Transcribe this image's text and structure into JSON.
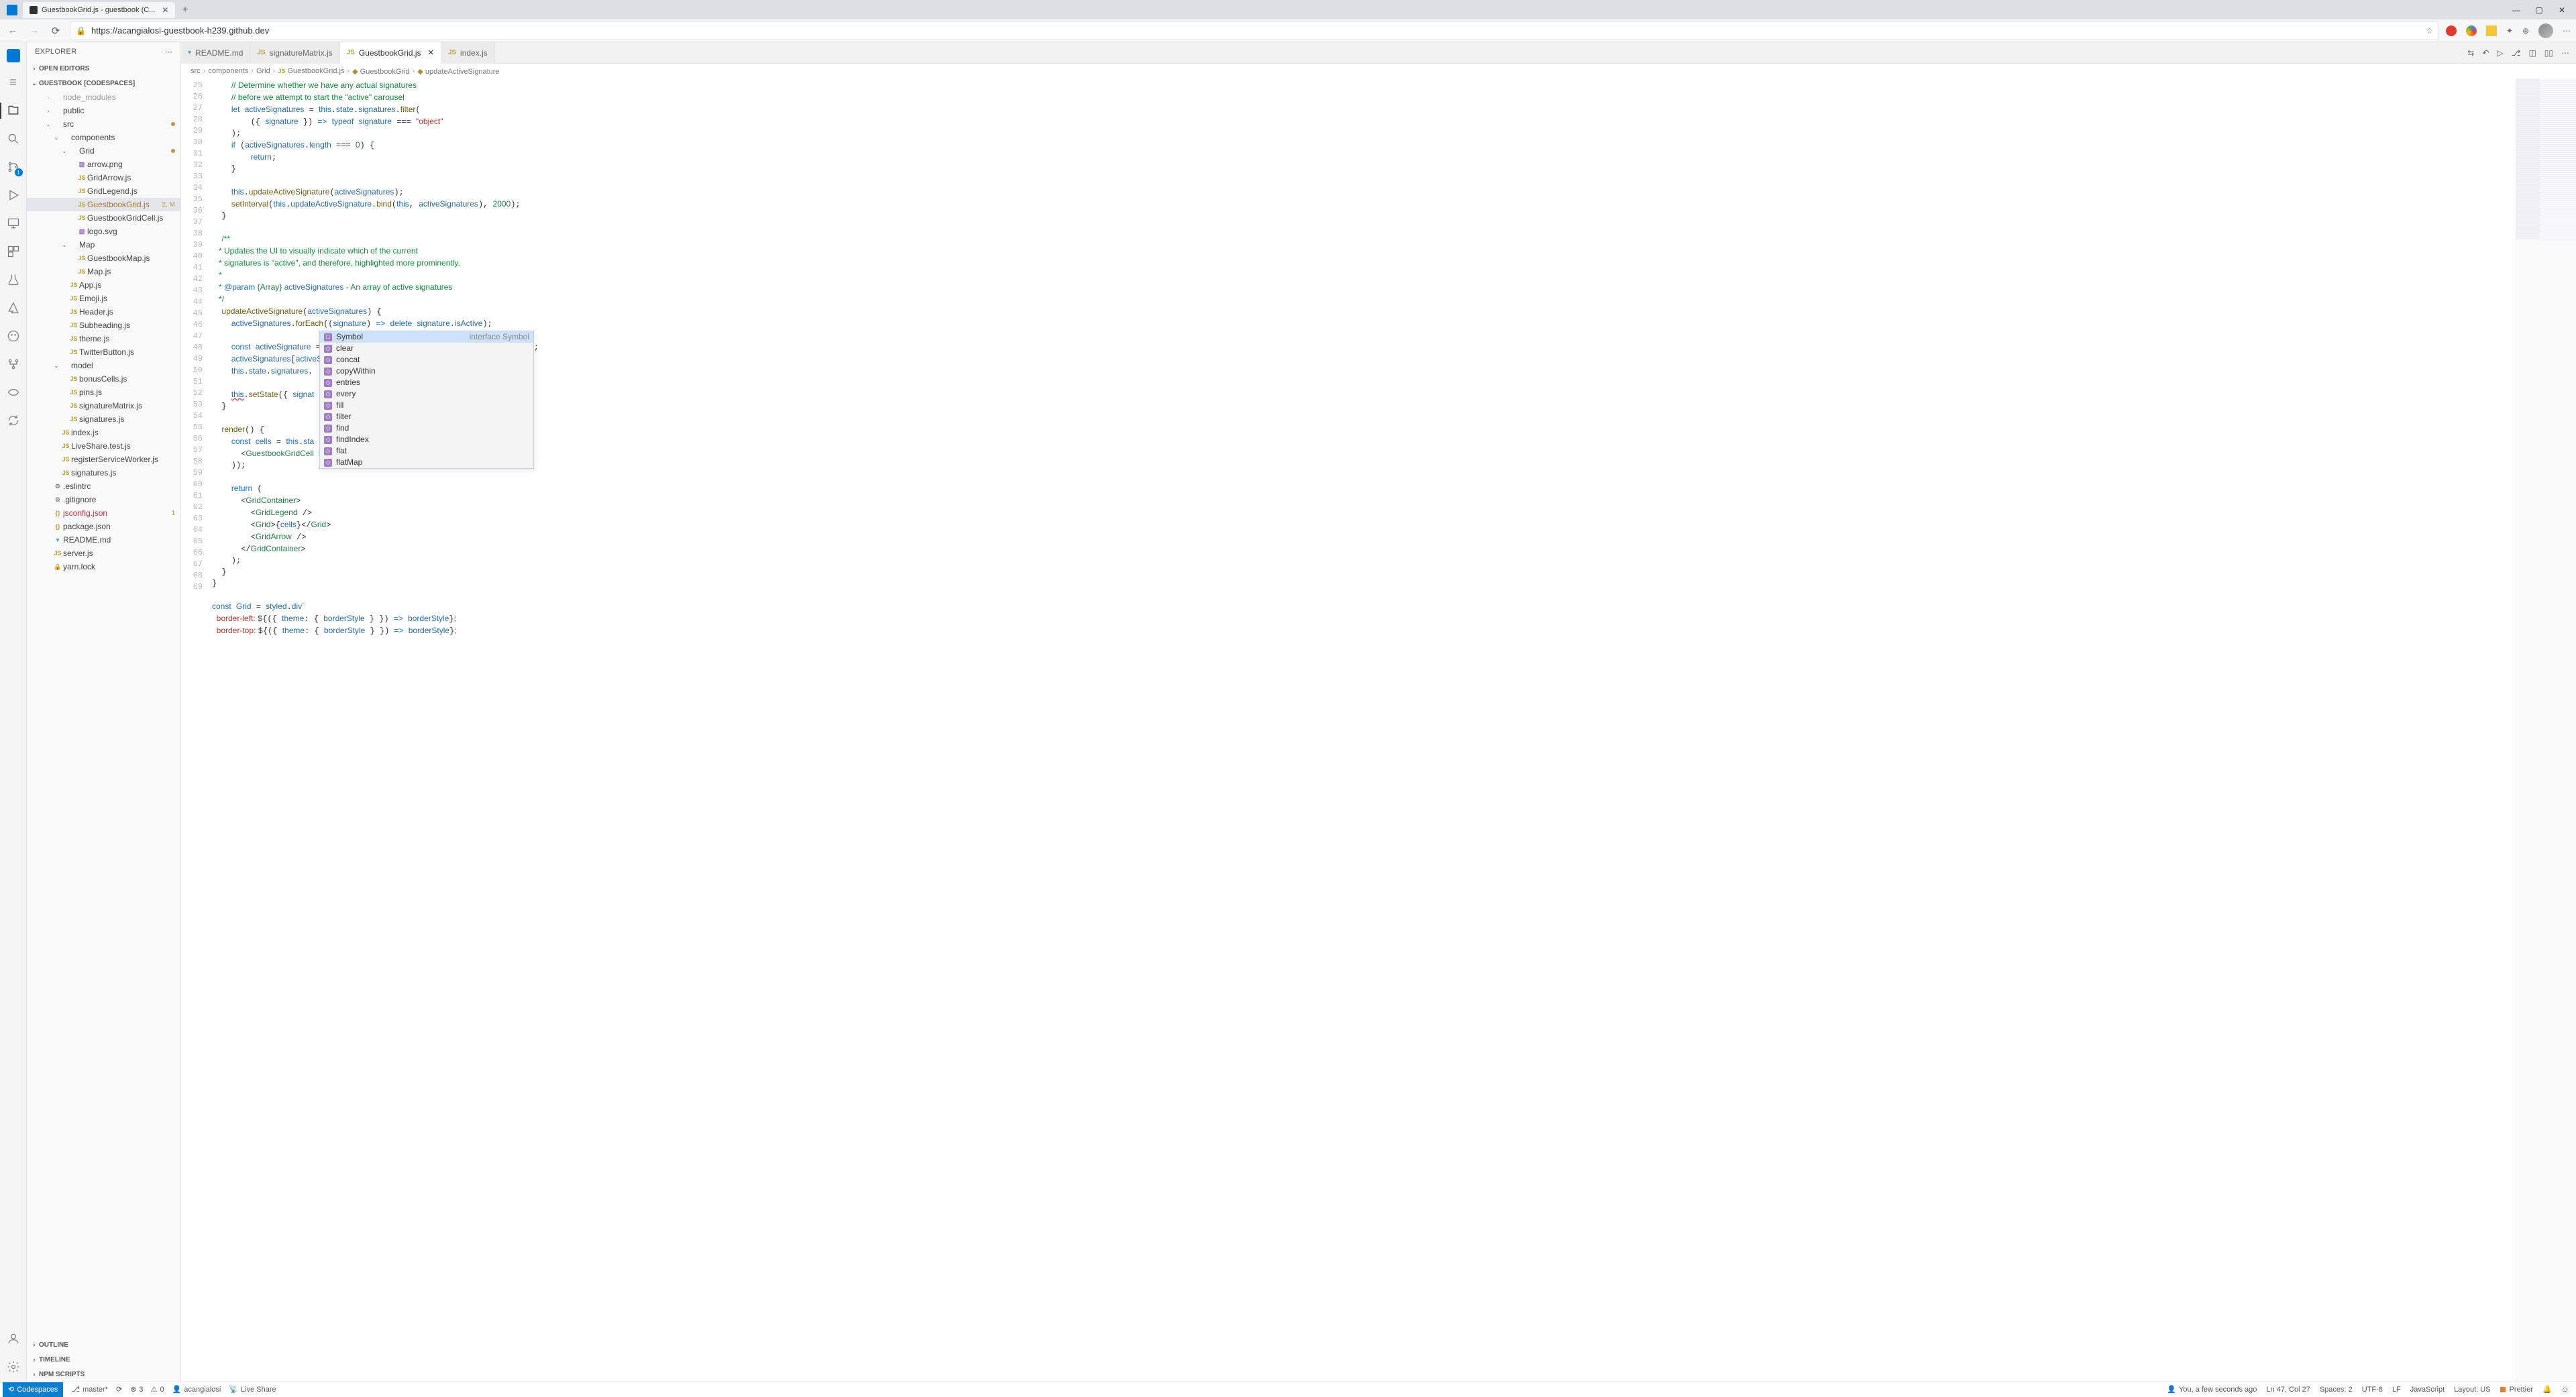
{
  "browser": {
    "tab_title": "GuestbookGrid.js - guestbook (C...",
    "url": "https://acangialosi-guestbook-h239.github.dev"
  },
  "window_controls": {
    "min": "—",
    "max": "▢",
    "close": "✕"
  },
  "sidebar": {
    "title": "Explorer",
    "sections": {
      "open_editors": "OPEN EDITORS",
      "repo": "GUESTBOOK [CODESPACES]",
      "outline": "OUTLINE",
      "timeline": "TIMELINE",
      "npm": "NPM SCRIPTS"
    },
    "tree": [
      {
        "name": "node_modules",
        "type": "folder",
        "indent": 2,
        "expanded": false,
        "dim": true
      },
      {
        "name": "public",
        "type": "folder",
        "indent": 2,
        "expanded": false
      },
      {
        "name": "src",
        "type": "folder",
        "indent": 2,
        "expanded": true,
        "dot": true
      },
      {
        "name": "components",
        "type": "folder",
        "indent": 3,
        "expanded": true
      },
      {
        "name": "Grid",
        "type": "folder",
        "indent": 4,
        "expanded": true,
        "dot": true
      },
      {
        "name": "arrow.png",
        "type": "img",
        "indent": 5
      },
      {
        "name": "GridArrow.js",
        "type": "js",
        "indent": 5
      },
      {
        "name": "GridLegend.js",
        "type": "js",
        "indent": 5
      },
      {
        "name": "GuestbookGrid.js",
        "type": "js",
        "indent": 5,
        "selected": true,
        "mark": "2, M",
        "modified": true
      },
      {
        "name": "GuestbookGridCell.js",
        "type": "js",
        "indent": 5
      },
      {
        "name": "logo.svg",
        "type": "img",
        "indent": 5
      },
      {
        "name": "Map",
        "type": "folder",
        "indent": 4,
        "expanded": true
      },
      {
        "name": "GuestbookMap.js",
        "type": "js",
        "indent": 5
      },
      {
        "name": "Map.js",
        "type": "js",
        "indent": 5
      },
      {
        "name": "App.js",
        "type": "js",
        "indent": 4
      },
      {
        "name": "Emoji.js",
        "type": "js",
        "indent": 4
      },
      {
        "name": "Header.js",
        "type": "js",
        "indent": 4
      },
      {
        "name": "Subheading.js",
        "type": "js",
        "indent": 4
      },
      {
        "name": "theme.js",
        "type": "js",
        "indent": 4
      },
      {
        "name": "TwitterButton.js",
        "type": "js",
        "indent": 4
      },
      {
        "name": "model",
        "type": "folder",
        "indent": 3,
        "expanded": true
      },
      {
        "name": "bonusCells.js",
        "type": "js",
        "indent": 4
      },
      {
        "name": "pins.js",
        "type": "js",
        "indent": 4
      },
      {
        "name": "signatureMatrix.js",
        "type": "js",
        "indent": 4
      },
      {
        "name": "signatures.js",
        "type": "js",
        "indent": 4
      },
      {
        "name": "index.js",
        "type": "js",
        "indent": 3
      },
      {
        "name": "LiveShare.test.js",
        "type": "js",
        "indent": 3
      },
      {
        "name": "registerServiceWorker.js",
        "type": "js",
        "indent": 3
      },
      {
        "name": "signatures.js",
        "type": "js",
        "indent": 3
      },
      {
        "name": ".eslintrc",
        "type": "config",
        "indent": 2
      },
      {
        "name": ".gitignore",
        "type": "config",
        "indent": 2
      },
      {
        "name": "jsconfig.json",
        "type": "json",
        "indent": 2,
        "error": true,
        "mark": "1"
      },
      {
        "name": "package.json",
        "type": "json",
        "indent": 2
      },
      {
        "name": "README.md",
        "type": "md",
        "indent": 2
      },
      {
        "name": "server.js",
        "type": "js",
        "indent": 2
      },
      {
        "name": "yarn.lock",
        "type": "lock",
        "indent": 2
      }
    ]
  },
  "tabs": [
    {
      "label": "README.md",
      "icon": "md"
    },
    {
      "label": "signatureMatrix.js",
      "icon": "js"
    },
    {
      "label": "GuestbookGrid.js",
      "icon": "js",
      "active": true,
      "close": true
    },
    {
      "label": "index.js",
      "icon": "js"
    }
  ],
  "breadcrumb": [
    "src",
    "components",
    "Grid",
    "GuestbookGrid.js",
    "GuestbookGrid",
    "updateActiveSignature"
  ],
  "gutter_start": 25,
  "gutter_end": 69,
  "suggest": {
    "detail": "interface Symbol",
    "items": [
      "Symbol",
      "clear",
      "concat",
      "copyWithin",
      "entries",
      "every",
      "fill",
      "filter",
      "find",
      "findIndex",
      "flat",
      "flatMap"
    ]
  },
  "statusbar": {
    "codespaces": "Codespaces",
    "branch": "master*",
    "sync": "",
    "errors": "3",
    "warnings": "0",
    "user": "acangialosi",
    "liveshare": "Live Share",
    "blame": "You, a few seconds ago",
    "lncol": "Ln 47, Col 27",
    "spaces": "Spaces: 2",
    "encoding": "UTF-8",
    "eol": "LF",
    "lang": "JavaScript",
    "layout": "Layout: US",
    "prettier": "Prettier"
  },
  "activity_badge": "1"
}
